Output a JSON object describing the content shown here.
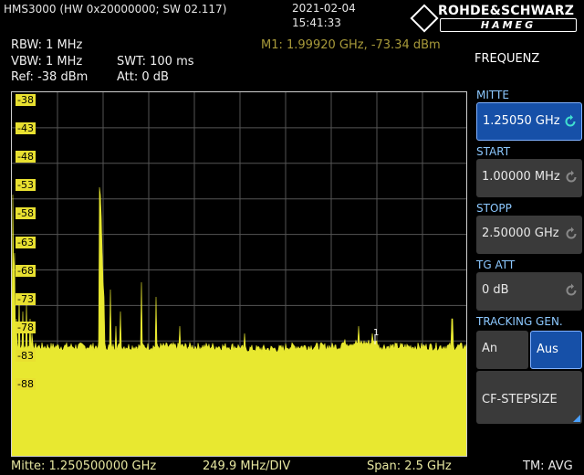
{
  "header": {
    "device": "HMS3000 (HW 0x20000000; SW 02.117)",
    "date": "2021-02-04",
    "time": "15:41:33",
    "brand_top": "ROHDE&SCHWARZ",
    "brand_bottom": "HAMEG"
  },
  "settings": {
    "rbw": "RBW: 1 MHz",
    "vbw": "VBW: 1 MHz",
    "swt": "SWT: 100 ms",
    "ref": "Ref: -38 dBm",
    "att": "Att: 0 dB",
    "marker": "M1: 1.99920 GHz, -73.34 dBm"
  },
  "graph": {
    "ylabels": [
      "-38",
      "-43",
      "-48",
      "-53",
      "-58",
      "-63",
      "-68",
      "-73",
      "-78",
      "-83",
      "-88"
    ],
    "marker_label": "1",
    "trace_color": "#e8e830",
    "grid_color": "#555555"
  },
  "footer": {
    "center": "Mitte: 1.250500000 GHz",
    "div": "249.9 MHz/DIV",
    "span": "Span: 2.5 GHz",
    "tm": "TM: AVG"
  },
  "sidebar": {
    "title": "FREQUENZ",
    "mitte_head": "MITTE",
    "mitte_value": "1.25050 GHz",
    "start_head": "START",
    "start_value": "1.00000 MHz",
    "stopp_head": "STOPP",
    "stopp_value": "2.50000 GHz",
    "tgatt_head": "TG ATT",
    "tgatt_value": "0 dB",
    "tracking_head": "TRACKING GEN.",
    "tracking_on": "An",
    "tracking_off": "Aus",
    "cf_step": "CF-STEPSIZE"
  }
}
